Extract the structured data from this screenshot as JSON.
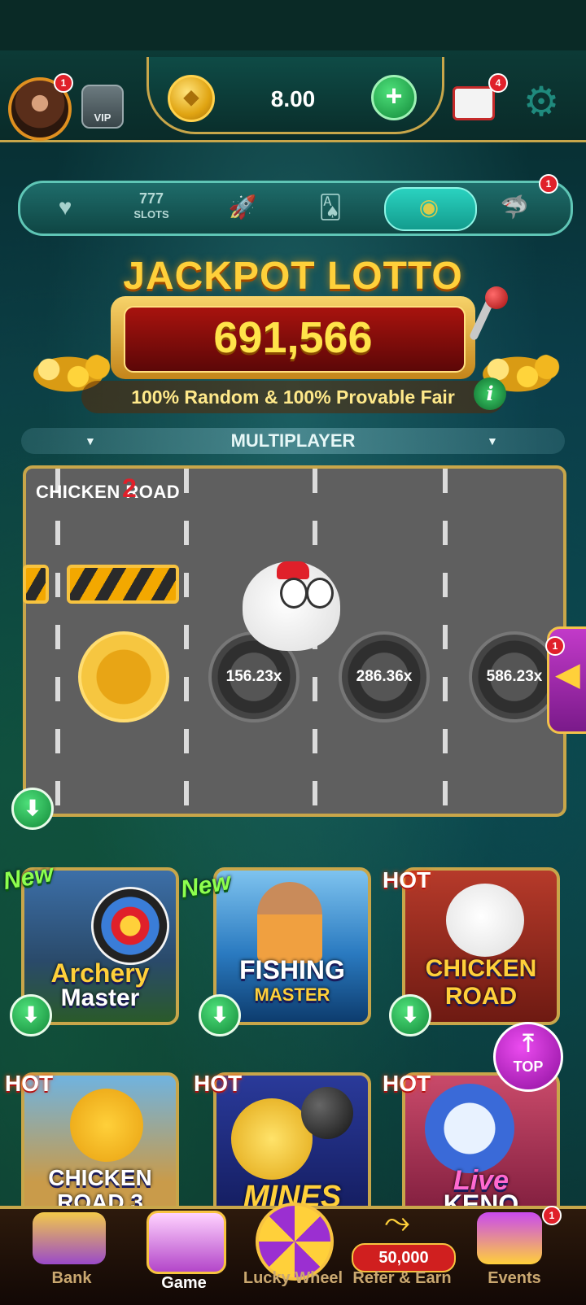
{
  "header": {
    "avatar_badge": "1",
    "vip_label": "VIP",
    "balance": "8.00",
    "add_label": "+",
    "mail_badge": "4"
  },
  "tabs": {
    "slots_label": "777",
    "slots_sub": "SLOTS",
    "shark_badge": "1"
  },
  "jackpot": {
    "title": "JACKPOT LOTTO",
    "value": "691,566",
    "subtitle": "100% Random & 100% Provable Fair",
    "info": "i"
  },
  "multiplayer": {
    "label": "MULTIPLAYER"
  },
  "board": {
    "logo": "CHICKEN ROAD",
    "logo_num": "2",
    "multipliers": [
      "156.23x",
      "286.36x",
      "586.23x"
    ],
    "side_badge": "1"
  },
  "games": [
    {
      "title_1": "Archery",
      "title_2": "Master",
      "tag": "New"
    },
    {
      "title_1": "FISHING",
      "title_2": "MASTER",
      "tag": "New"
    },
    {
      "title_1": "CHICKEN",
      "title_2": "ROAD",
      "tag": "HOT"
    },
    {
      "title_1": "CHICKEN",
      "title_2": "ROAD 3",
      "tag": "HOT"
    },
    {
      "title_1": "MINES",
      "title_2": "",
      "tag": "HOT"
    },
    {
      "title_1": "Live",
      "title_2": "KENO",
      "tag": "HOT"
    }
  ],
  "top_button": "TOP",
  "nav": {
    "bank": "Bank",
    "game": "Game",
    "lucky_wheel": "Lucky Wheel",
    "refer": "Refer & Earn",
    "refer_amount": "50,000",
    "events": "Events",
    "events_badge": "1"
  }
}
